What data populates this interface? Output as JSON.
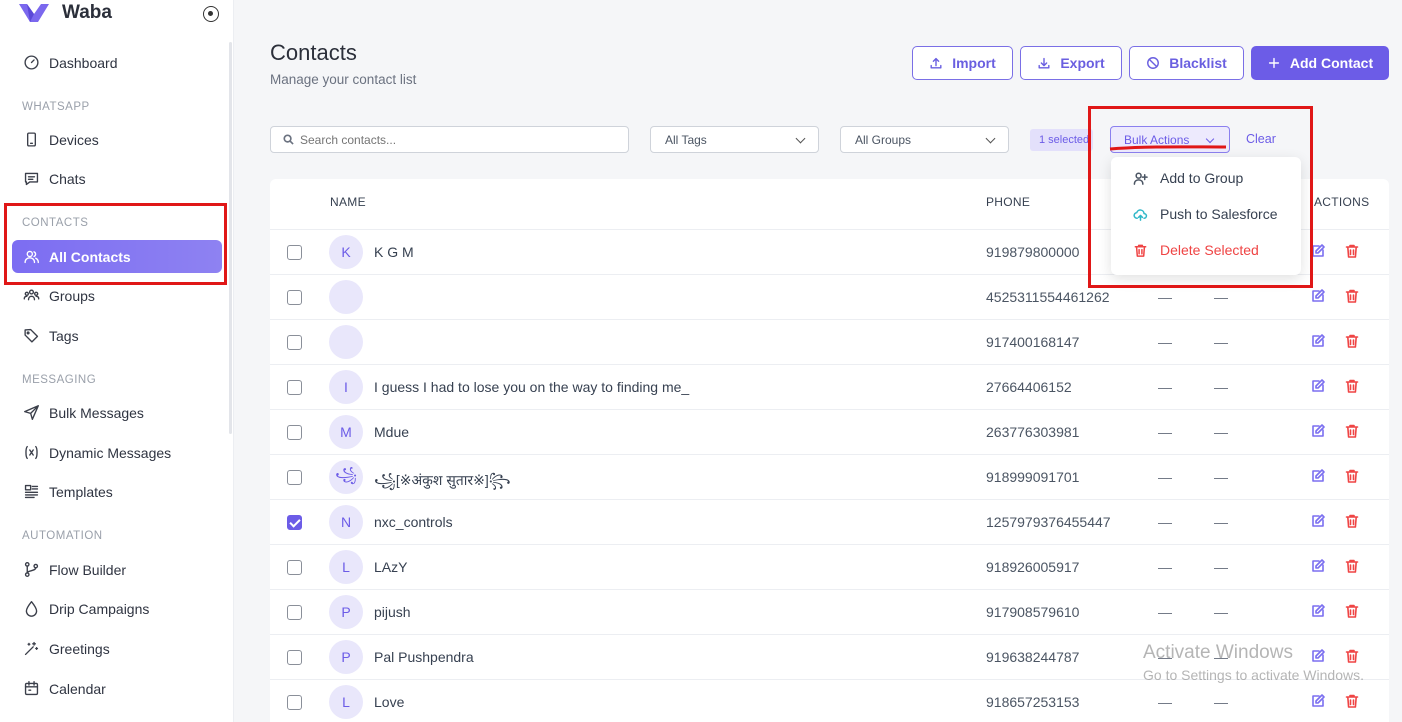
{
  "app": {
    "name": "Waba"
  },
  "sidebar": {
    "dashboard": "Dashboard",
    "sections": {
      "whatsapp": "WHATSAPP",
      "contacts": "CONTACTS",
      "messaging": "MESSAGING",
      "automation": "AUTOMATION"
    },
    "items": {
      "devices": "Devices",
      "chats": "Chats",
      "all_contacts": "All Contacts",
      "groups": "Groups",
      "tags": "Tags",
      "bulk_messages": "Bulk Messages",
      "dynamic_messages": "Dynamic Messages",
      "templates": "Templates",
      "flow_builder": "Flow Builder",
      "drip_campaigns": "Drip Campaigns",
      "greetings": "Greetings",
      "calendar": "Calendar"
    },
    "active": "all_contacts"
  },
  "header": {
    "title": "Contacts",
    "subtitle": "Manage your contact list",
    "buttons": {
      "import": "Import",
      "export": "Export",
      "blacklist": "Blacklist",
      "add_contact": "Add Contact"
    }
  },
  "filters": {
    "search_placeholder": "Search contacts...",
    "tags": "All Tags",
    "groups": "All Groups",
    "selected": "1 selected",
    "bulk_actions": "Bulk Actions",
    "clear": "Clear"
  },
  "bulk_menu": {
    "add_to_group": "Add to Group",
    "push_to_salesforce": "Push to Salesforce",
    "delete_selected": "Delete Selected"
  },
  "table": {
    "columns": {
      "name": "NAME",
      "phone": "PHONE",
      "actions": "ACTIONS"
    },
    "empty_value": "—",
    "rows": [
      {
        "initial": "K",
        "name": "K G M",
        "phone": "919879800000",
        "checked": false
      },
      {
        "initial": "",
        "name": "",
        "phone": "4525311554461262",
        "checked": false
      },
      {
        "initial": "",
        "name": "",
        "phone": "917400168147",
        "checked": false
      },
      {
        "initial": "I",
        "name": "I guess I had to lose you on the way to finding me_",
        "phone": "27664406152",
        "checked": false
      },
      {
        "initial": "M",
        "name": "Mdue",
        "phone": "263776303981",
        "checked": false
      },
      {
        "initial": "꧁",
        "name": "꧁[※अंकुश सुतार※]꧂",
        "phone": "918999091701",
        "checked": false
      },
      {
        "initial": "N",
        "name": "nxc_controls",
        "phone": "1257979376455447",
        "checked": true
      },
      {
        "initial": "L",
        "name": "LAzY",
        "phone": "918926005917",
        "checked": false
      },
      {
        "initial": "P",
        "name": "pijush",
        "phone": "917908579610",
        "checked": false
      },
      {
        "initial": "P",
        "name": "Pal Pushpendra",
        "phone": "919638244787",
        "checked": false
      },
      {
        "initial": "L",
        "name": "Love",
        "phone": "918657253153",
        "checked": false
      }
    ]
  },
  "watermark": {
    "line1": "Activate Windows",
    "line2": "Go to Settings to activate Windows."
  },
  "colors": {
    "accent": "#6c5ce7",
    "danger": "#ef4444",
    "annotation": "#e01717"
  }
}
